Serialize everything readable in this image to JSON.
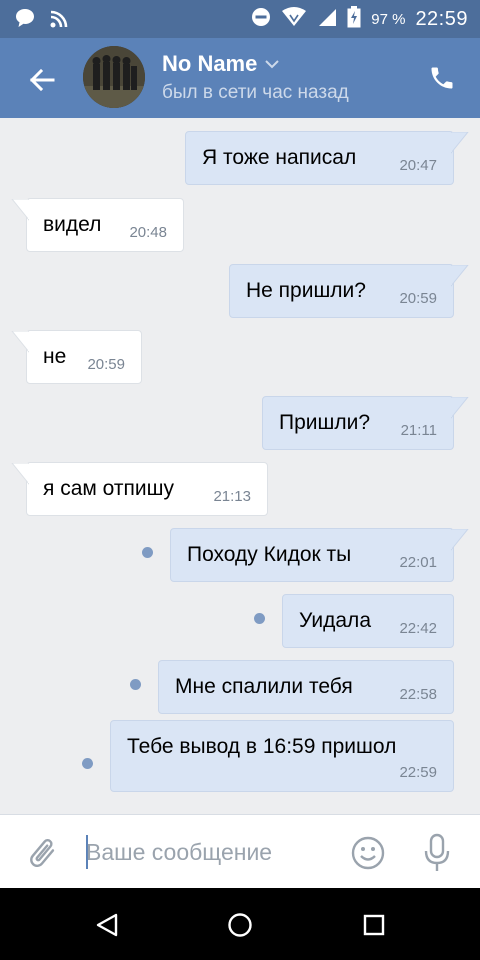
{
  "status_bar": {
    "battery_percent": "97 %",
    "time": "22:59",
    "icons": [
      "chat-bubble-icon",
      "wifi-off-icon",
      "dnd-icon",
      "vpn-wifi-icon",
      "signal-icon",
      "battery-icon"
    ]
  },
  "header": {
    "name": "No Name",
    "status": "был в сети час назад",
    "icons": [
      "back-arrow-icon",
      "chevron-down-icon",
      "phone-icon"
    ]
  },
  "messages": [
    {
      "dir": "out",
      "text": "Я тоже написал",
      "time": "20:47",
      "unread": false
    },
    {
      "dir": "in",
      "text": "видел",
      "time": "20:48",
      "unread": false
    },
    {
      "dir": "out",
      "text": "Не пришли?",
      "time": "20:59",
      "unread": false
    },
    {
      "dir": "in",
      "text": "не",
      "time": "20:59",
      "unread": false
    },
    {
      "dir": "out",
      "text": "Пришли?",
      "time": "21:11",
      "unread": false
    },
    {
      "dir": "in",
      "text": "я сам отпишу",
      "time": "21:13",
      "unread": false
    },
    {
      "dir": "out",
      "text": "Походу Кидок ты",
      "time": "22:01",
      "unread": true
    },
    {
      "dir": "out",
      "text": "Уидала",
      "time": "22:42",
      "unread": true
    },
    {
      "dir": "out",
      "text": "Мне спалили тебя",
      "time": "22:58",
      "unread": true
    },
    {
      "dir": "out",
      "text": "Тебе вывод в 16:59 пришол",
      "time": "22:59",
      "unread": true
    }
  ],
  "composer": {
    "placeholder": "Ваше сообщение",
    "value": "",
    "icons": [
      "paperclip-icon",
      "emoji-icon",
      "microphone-icon"
    ]
  },
  "navigation_bar": {
    "icons": [
      "back-triangle-icon",
      "home-circle-icon",
      "recents-square-icon"
    ]
  },
  "colors": {
    "header": "#5b82b8",
    "status_bar": "#4d6e9b",
    "background": "#edeef0",
    "outgoing_bubble": "#dae5f5",
    "incoming_bubble": "#ffffff",
    "unread_dot": "#7f9bc3"
  }
}
